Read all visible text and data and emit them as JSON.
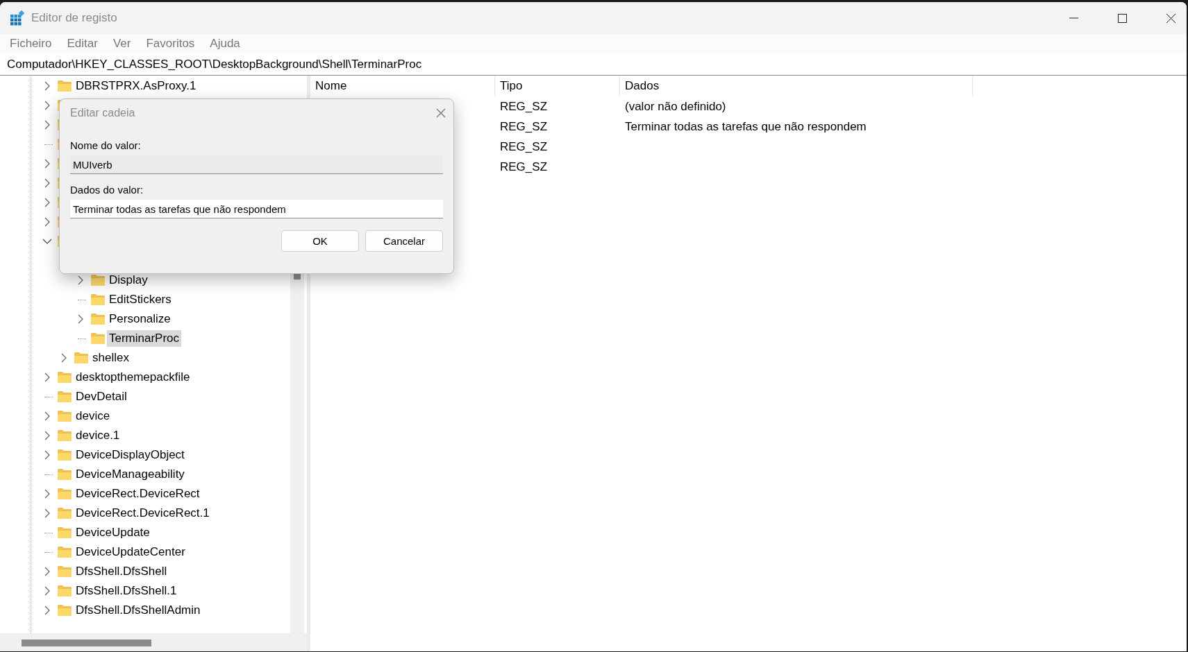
{
  "window": {
    "title": "Editor de registo"
  },
  "menu": [
    "Ficheiro",
    "Editar",
    "Ver",
    "Favoritos",
    "Ajuda"
  ],
  "address": "Computador\\HKEY_CLASSES_ROOT\\DesktopBackground\\Shell\\TerminarProc",
  "tree": {
    "items": [
      {
        "label": "DBRSTPRX.AsProxy.1",
        "expandable": true,
        "expanded": false,
        "selected": false
      },
      {
        "expandable": true,
        "expanded": false
      },
      {
        "expandable": true,
        "expanded": false
      },
      {
        "expandable": false
      },
      {
        "expandable": true,
        "expanded": false
      },
      {
        "expandable": true,
        "expanded": false
      },
      {
        "expandable": true,
        "expanded": false
      },
      {
        "expandable": true,
        "expanded": false
      },
      {
        "expandable": true,
        "expanded": true,
        "children": [
          {
            "children": [
              {
                "label": "Display",
                "expandable": true,
                "expanded": false,
                "selected": false
              },
              {
                "label": "EditStickers",
                "expandable": false,
                "selected": false
              },
              {
                "label": "Personalize",
                "expandable": true,
                "expanded": false,
                "selected": false
              },
              {
                "label": "TerminarProc",
                "expandable": false,
                "selected": true
              }
            ]
          },
          {
            "label": "shellex",
            "expandable": true,
            "expanded": false,
            "selected": false
          }
        ]
      },
      {
        "label": "desktopthemepackfile",
        "expandable": true,
        "expanded": false,
        "selected": false
      },
      {
        "label": "DevDetail",
        "expandable": false,
        "selected": false
      },
      {
        "label": "device",
        "expandable": true,
        "expanded": false,
        "selected": false
      },
      {
        "label": "device.1",
        "expandable": true,
        "expanded": false,
        "selected": false
      },
      {
        "label": "DeviceDisplayObject",
        "expandable": true,
        "expanded": false,
        "selected": false
      },
      {
        "label": "DeviceManageability",
        "expandable": false,
        "selected": false
      },
      {
        "label": "DeviceRect.DeviceRect",
        "expandable": true,
        "expanded": false,
        "selected": false
      },
      {
        "label": "DeviceRect.DeviceRect.1",
        "expandable": true,
        "expanded": false,
        "selected": false
      },
      {
        "label": "DeviceUpdate",
        "expandable": false,
        "selected": false
      },
      {
        "label": "DeviceUpdateCenter",
        "expandable": false,
        "selected": false
      },
      {
        "label": "DfsShell.DfsShell",
        "expandable": true,
        "expanded": false,
        "selected": false
      },
      {
        "label": "DfsShell.DfsShell.1",
        "expandable": true,
        "expanded": false,
        "selected": false
      },
      {
        "label": "DfsShell.DfsShellAdmin",
        "expandable": true,
        "expanded": false,
        "selected": false
      }
    ]
  },
  "values": {
    "columns": [
      "Nome",
      "Tipo",
      "Dados"
    ],
    "rows": [
      {
        "type": "REG_SZ",
        "data": "(valor não definido)"
      },
      {
        "type": "REG_SZ",
        "data": "Terminar todas as tarefas que não respondem"
      },
      {
        "type": "REG_SZ"
      },
      {
        "type": "REG_SZ"
      }
    ]
  },
  "dialog": {
    "title": "Editar cadeia",
    "name_label": "Nome do valor:",
    "name_value": "MUIverb",
    "data_label": "Dados do valor:",
    "data_value": "Terminar todas as tarefas que não respondem",
    "buttons": [
      "OK",
      "Cancelar"
    ]
  }
}
